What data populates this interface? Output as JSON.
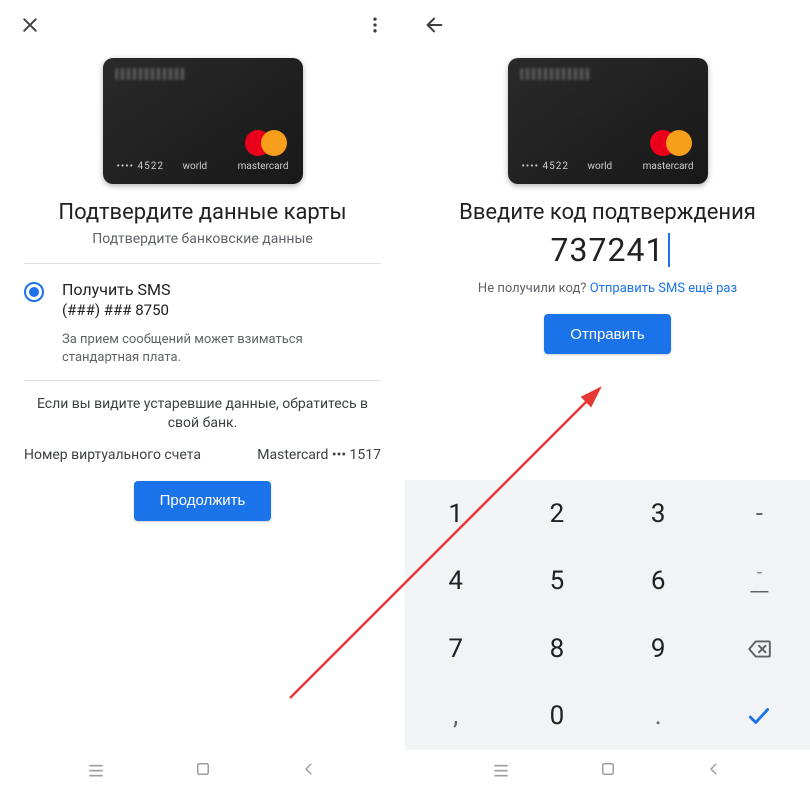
{
  "left": {
    "card": {
      "last4": "•••• 4522",
      "tier": "world",
      "brand": "mastercard"
    },
    "title": "Подтвердите данные карты",
    "subtitle": "Подтвердите банковские данные",
    "option": {
      "title": "Получить SMS",
      "phone": "(###) ### 8750",
      "note": "За прием сообщений может взиматься стандартная плата."
    },
    "bank_note": "Если вы видите устаревшие данные, обратитесь в свой банк.",
    "virtual_label": "Номер виртуального счета",
    "virtual_value": "Mastercard ••• 1517",
    "continue": "Продолжить"
  },
  "right": {
    "card": {
      "last4": "•••• 4522",
      "tier": "world",
      "brand": "mastercard"
    },
    "title": "Введите код подтверждения",
    "code": "737241",
    "resend_q": "Не получили код?",
    "resend_a": "Отправить SMS ещё раз",
    "submit": "Отправить",
    "keys": {
      "k1": "1",
      "k2": "2",
      "k3": "3",
      "dash": "-",
      "k4": "4",
      "k5": "5",
      "k6": "6",
      "under": "__",
      "k7": "7",
      "k8": "8",
      "k9": "9",
      "comma": ",",
      "k0": "0",
      "dot": "."
    }
  }
}
